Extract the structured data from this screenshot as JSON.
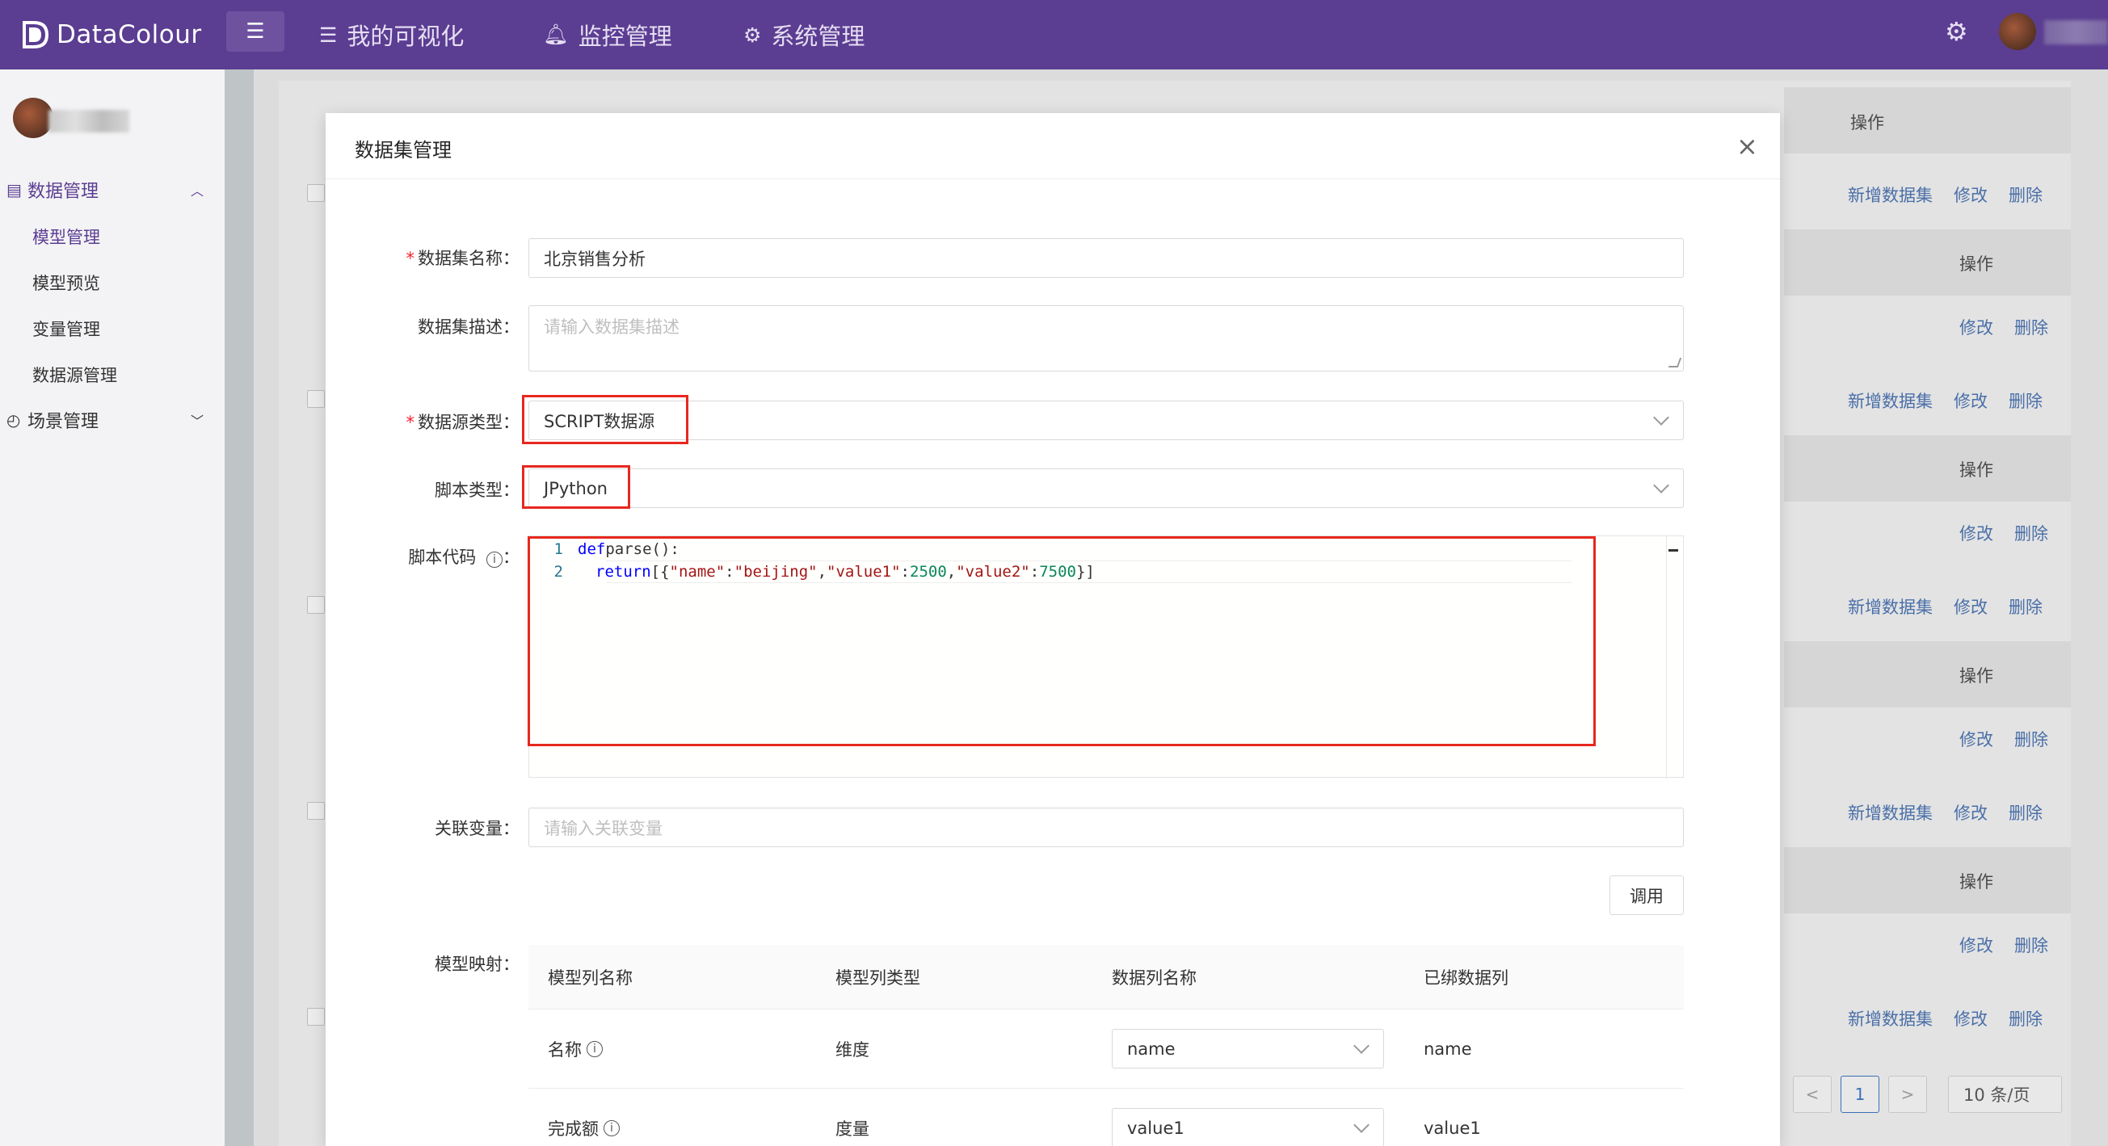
{
  "app": {
    "logo_text": "DataColour",
    "nav": [
      {
        "label": "我的可视化",
        "icon": "list-icon"
      },
      {
        "label": "监控管理",
        "icon": "bell-icon"
      },
      {
        "label": "系统管理",
        "icon": "gear-icon"
      }
    ]
  },
  "sidebar": {
    "groups": [
      {
        "label": "数据管理",
        "icon": "database-icon",
        "expanded": true
      },
      {
        "label": "场景管理",
        "icon": "dashboard-icon",
        "expanded": false
      }
    ],
    "items": [
      "模型管理",
      "模型预览",
      "变量管理",
      "数据源管理"
    ],
    "active_item": "模型管理"
  },
  "background": {
    "header_label": "操作",
    "row_links": {
      "add": "新增数据集",
      "edit": "修改",
      "delete": "删除"
    },
    "pagination": {
      "prev": "<",
      "current": "1",
      "next": ">",
      "page_size": "10 条/页"
    }
  },
  "modal": {
    "title": "数据集管理",
    "close": "×",
    "fields": {
      "name_label": "数据集名称",
      "name_value": "北京销售分析",
      "desc_label": "数据集描述",
      "desc_placeholder": "请输入数据集描述",
      "source_type_label": "数据源类型",
      "source_type_value": "SCRIPT数据源",
      "script_type_label": "脚本类型",
      "script_type_value": "JPython",
      "script_code_label": "脚本代码",
      "related_var_label": "关联变量",
      "related_var_placeholder": "请输入关联变量",
      "model_mapping_label": "模型映射"
    },
    "code": {
      "line1_no": "1",
      "line1_kw": "def",
      "line1_rest": " parse():",
      "line2_no": "2",
      "line2_kw": "return",
      "line2_open": " [{",
      "key1": "\"name\"",
      "colon1": ":",
      "val1": "\"beijing\"",
      "comma1": ",",
      "key2": "\"value1\"",
      "colon2": ":",
      "num1": "2500",
      "comma2": ",",
      "key3": "\"value2\"",
      "colon3": ":",
      "num2": "7500",
      "close": "}]"
    },
    "invoke_button": "调用",
    "mapping_table": {
      "headers": [
        "模型列名称",
        "模型列类型",
        "数据列名称",
        "已绑数据列"
      ],
      "rows": [
        {
          "model_col": "名称",
          "type": "维度",
          "data_col": "name",
          "bound": "name"
        },
        {
          "model_col": "完成额",
          "type": "度量",
          "data_col": "value1",
          "bound": "value1"
        }
      ]
    }
  }
}
